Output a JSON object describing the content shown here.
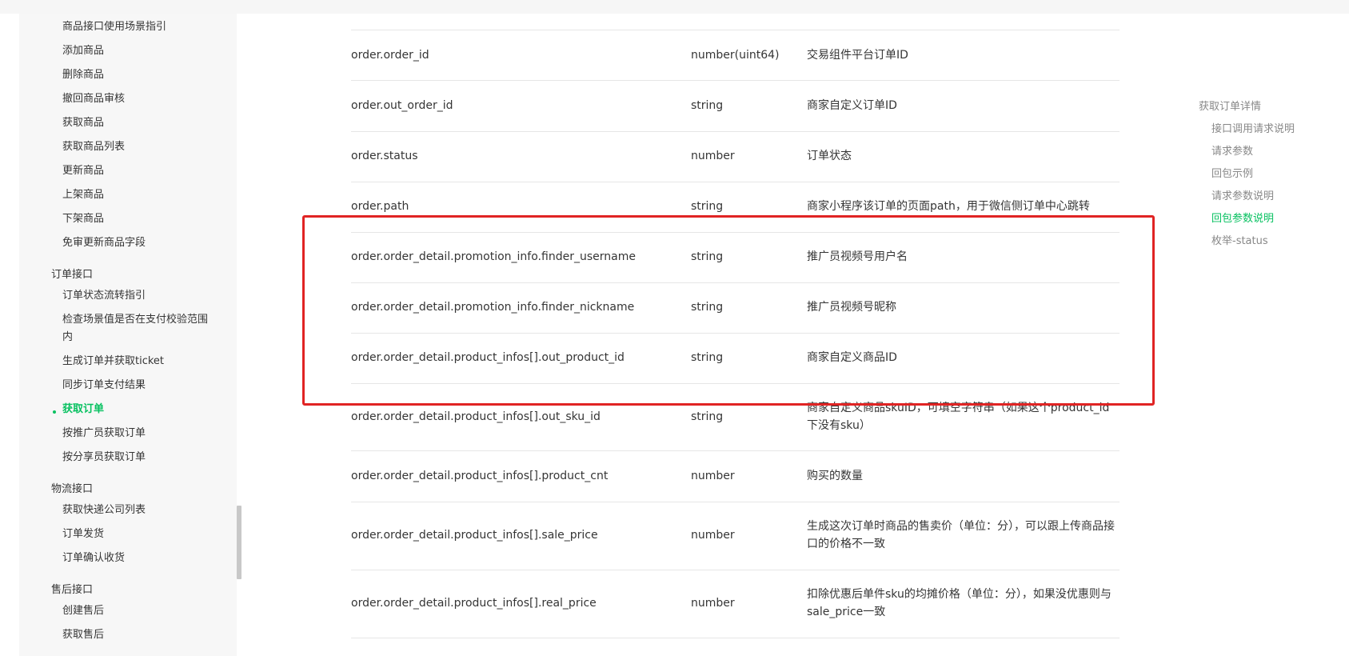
{
  "sidebar": {
    "items": [
      {
        "label": "商品接口使用场景指引"
      },
      {
        "label": "添加商品"
      },
      {
        "label": "删除商品"
      },
      {
        "label": "撤回商品审核"
      },
      {
        "label": "获取商品"
      },
      {
        "label": "获取商品列表"
      },
      {
        "label": "更新商品"
      },
      {
        "label": "上架商品"
      },
      {
        "label": "下架商品"
      },
      {
        "label": "免审更新商品字段"
      }
    ],
    "order_group": "订单接口",
    "order_items": [
      {
        "label": "订单状态流转指引"
      },
      {
        "label": "检查场景值是否在支付校验范围内"
      },
      {
        "label": "生成订单并获取ticket"
      },
      {
        "label": "同步订单支付结果"
      },
      {
        "label": "获取订单"
      },
      {
        "label": "按推广员获取订单"
      },
      {
        "label": "按分享员获取订单"
      }
    ],
    "active_label": "获取订单",
    "logistics_group": "物流接口",
    "logistics_items": [
      {
        "label": "获取快递公司列表"
      },
      {
        "label": "订单发货"
      },
      {
        "label": "订单确认收货"
      }
    ],
    "aftersale_group": "售后接口",
    "aftersale_items": [
      {
        "label": "创建售后"
      },
      {
        "label": "获取售后"
      }
    ]
  },
  "table": {
    "rows": [
      {
        "name": "order.order_id",
        "type": "number(uint64)",
        "desc": "交易组件平台订单ID"
      },
      {
        "name": "order.out_order_id",
        "type": "string",
        "desc": "商家自定义订单ID"
      },
      {
        "name": "order.status",
        "type": "number",
        "desc": "订单状态"
      },
      {
        "name": "order.path",
        "type": "string",
        "desc": "商家小程序该订单的页面path，用于微信侧订单中心跳转"
      },
      {
        "name": "order.order_detail.promotion_info.finder_username",
        "type": "string",
        "desc": "推广员视频号用户名"
      },
      {
        "name": "order.order_detail.promotion_info.finder_nickname",
        "type": "string",
        "desc": "推广员视频号昵称"
      },
      {
        "name": "order.order_detail.product_infos[].out_product_id",
        "type": "string",
        "desc": "商家自定义商品ID"
      },
      {
        "name": "order.order_detail.product_infos[].out_sku_id",
        "type": "string",
        "desc": "商家自定义商品skuID，可填空字符串（如果这个product_id下没有sku）"
      },
      {
        "name": "order.order_detail.product_infos[].product_cnt",
        "type": "number",
        "desc": "购买的数量"
      },
      {
        "name": "order.order_detail.product_infos[].sale_price",
        "type": "number",
        "desc": "生成这次订单时商品的售卖价（单位：分），可以跟上传商品接口的价格不一致"
      },
      {
        "name": "order.order_detail.product_infos[].real_price",
        "type": "number",
        "desc": "扣除优惠后单件sku的均摊价格（单位：分），如果没优惠则与sale_price一致"
      }
    ]
  },
  "toc": {
    "title": "获取订单详情",
    "items": [
      {
        "label": "接口调用请求说明"
      },
      {
        "label": "请求参数"
      },
      {
        "label": "回包示例"
      },
      {
        "label": "请求参数说明"
      },
      {
        "label": "回包参数说明"
      },
      {
        "label": "枚举-status"
      }
    ],
    "active_index": 4
  },
  "colors": {
    "accent": "#07c160",
    "highlight": "#e02424"
  }
}
